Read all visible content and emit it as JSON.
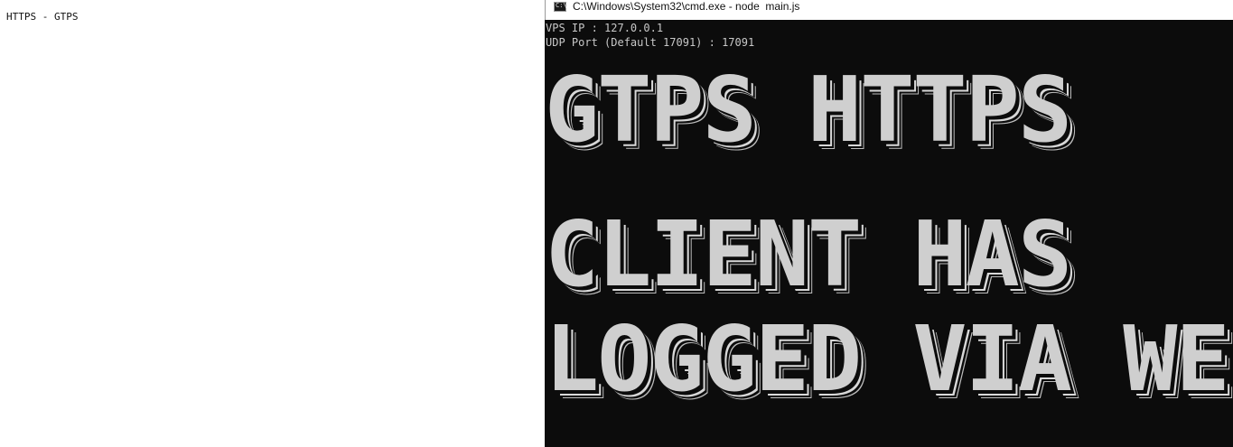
{
  "left_pane": {
    "text": "HTTPS - GTPS"
  },
  "cmd_window": {
    "title": "C:\\Windows\\System32\\cmd.exe - node  main.js",
    "icon": "cmd-icon",
    "icon_glyph": "C:\\",
    "lines": [
      "VPS IP : 127.0.0.1",
      "UDP Port (Default 17091) : 17091"
    ],
    "ascii_banner": [
      "GTPS HTTPS",
      "CLIENT HAS",
      "LOGGED VIA WE"
    ],
    "colors": {
      "background": "#0c0c0c",
      "text": "#c8c8c8"
    }
  }
}
